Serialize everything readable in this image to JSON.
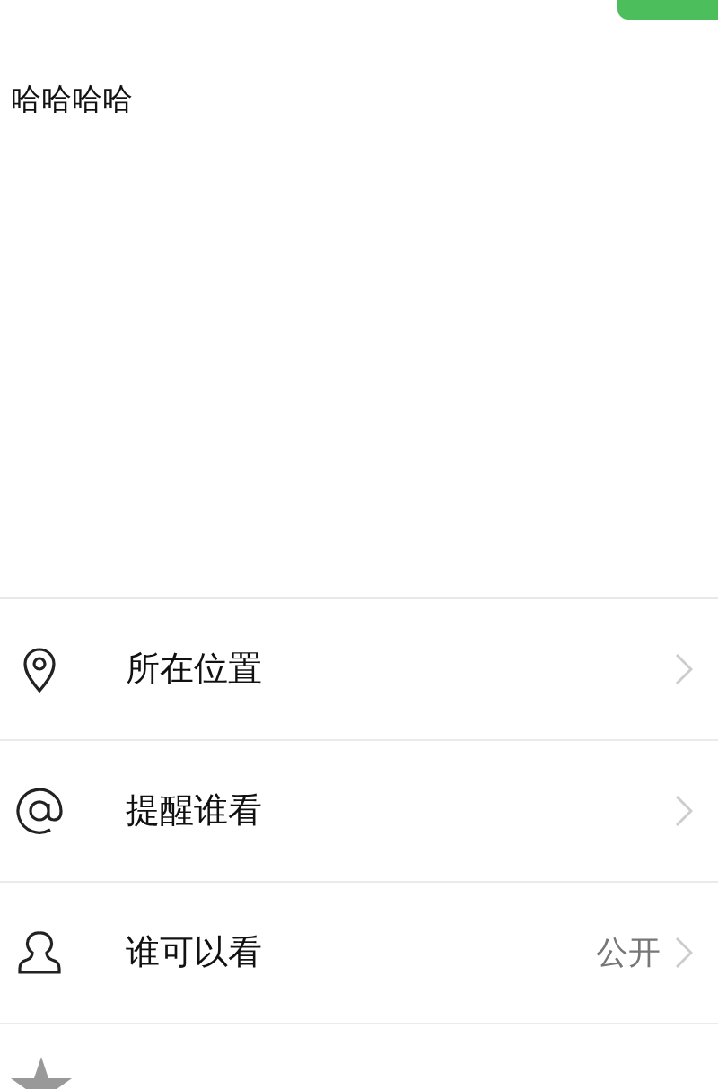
{
  "post": {
    "text": "哈哈哈哈"
  },
  "options": [
    {
      "kind": "location",
      "label": "所在位置"
    },
    {
      "kind": "mention",
      "label": "提醒谁看"
    },
    {
      "kind": "visibility",
      "label": "谁可以看",
      "value": "公开"
    },
    {
      "kind": "star"
    }
  ]
}
